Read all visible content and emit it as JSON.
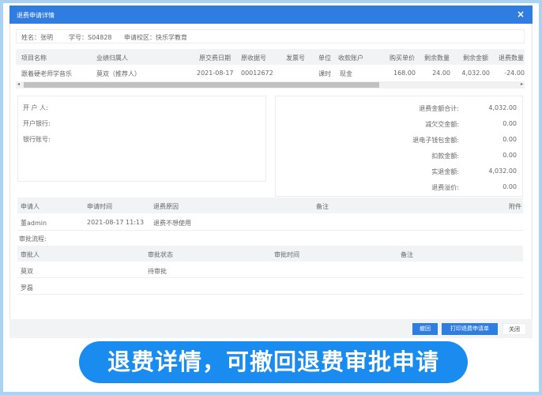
{
  "dialog": {
    "title": "退费申请详情",
    "close": "×"
  },
  "info": {
    "name": "姓名：张明",
    "student_no": "学号：S04828",
    "campus": "申请校区：快乐学教育"
  },
  "items_table": {
    "headers": [
      "项目名称",
      "业绩归属人",
      "原交费日期",
      "原收据号",
      "发票号",
      "单位",
      "收款账户",
      "购买单价",
      "剩余数量",
      "剩余金额",
      "退费数量"
    ],
    "rows": [
      [
        "跟着硬老师学音乐",
        "莫双（推荐人）",
        "2021-08-17",
        "00012672",
        "",
        "课时",
        "现金",
        "168.00",
        "24.00",
        "4,032.00",
        "-24.00"
      ]
    ]
  },
  "bank": {
    "holder": "开 户 人:",
    "bank": "开户银行:",
    "account": "银行账号:"
  },
  "summary": [
    {
      "label": "退费金额合计:",
      "value": "4,032.00"
    },
    {
      "label": "减欠交金额:",
      "value": "0.00"
    },
    {
      "label": "退电子钱包金额:",
      "value": "0.00"
    },
    {
      "label": "扣款金额:",
      "value": "0.00"
    },
    {
      "label": "实退金额:",
      "value": "4,032.00"
    },
    {
      "label": "退费溢价:",
      "value": "0.00"
    }
  ],
  "apply_table": {
    "headers": [
      "申请人",
      "申请时间",
      "退费原因",
      "备注",
      "附件"
    ],
    "rows": [
      [
        "董admin",
        "2021-08-17 11:13",
        "退费不想使用",
        "",
        ""
      ]
    ]
  },
  "approval": {
    "title": "审批流程:",
    "headers": [
      "审批人",
      "审批状态",
      "审批时间",
      "备注"
    ],
    "rows": [
      [
        "莫双",
        "待审批",
        "",
        ""
      ],
      [
        "罗磊",
        "",
        "",
        ""
      ]
    ]
  },
  "footer": {
    "revoke": "撤回",
    "print": "打印退费申请单",
    "close": "关闭"
  },
  "caption": "退费详情，可撤回退费审批申请",
  "colors": {
    "primary": "#2f7de1",
    "caption": "#1a8cf0",
    "frame": "#a9d2f3"
  }
}
